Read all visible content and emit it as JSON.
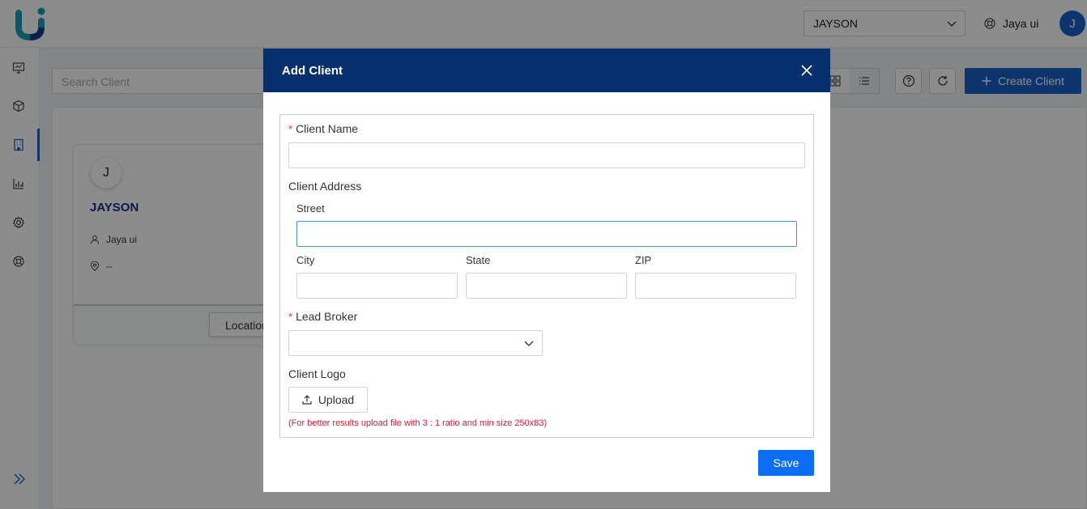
{
  "header": {
    "workspace_selected": "JAYSON",
    "user_name": "Jaya ui",
    "avatar_initial": "J"
  },
  "toolbar": {
    "search_placeholder": "Search Client",
    "create_label": "Create Client"
  },
  "client_card": {
    "initial": "J",
    "name": "JAYSON",
    "owner": "Jaya ui",
    "location": "--",
    "location_button": "Location"
  },
  "modal": {
    "title": "Add Client",
    "client_name_label": "Client Name",
    "client_address_label": "Client Address",
    "street_label": "Street",
    "city_label": "City",
    "state_label": "State",
    "zip_label": "ZIP",
    "lead_broker_label": "Lead Broker",
    "client_logo_label": "Client Logo",
    "upload_label": "Upload",
    "upload_hint": "(For better results upload file with 3 : 1 ratio and min size 250x83)",
    "save_label": "Save",
    "required_mark": "*"
  },
  "colors": {
    "primary": "#1a5fc8",
    "modal_header": "#062f6e",
    "save_button": "#0b6ef5",
    "required": "#e0245e",
    "hint": "#d0213a"
  }
}
